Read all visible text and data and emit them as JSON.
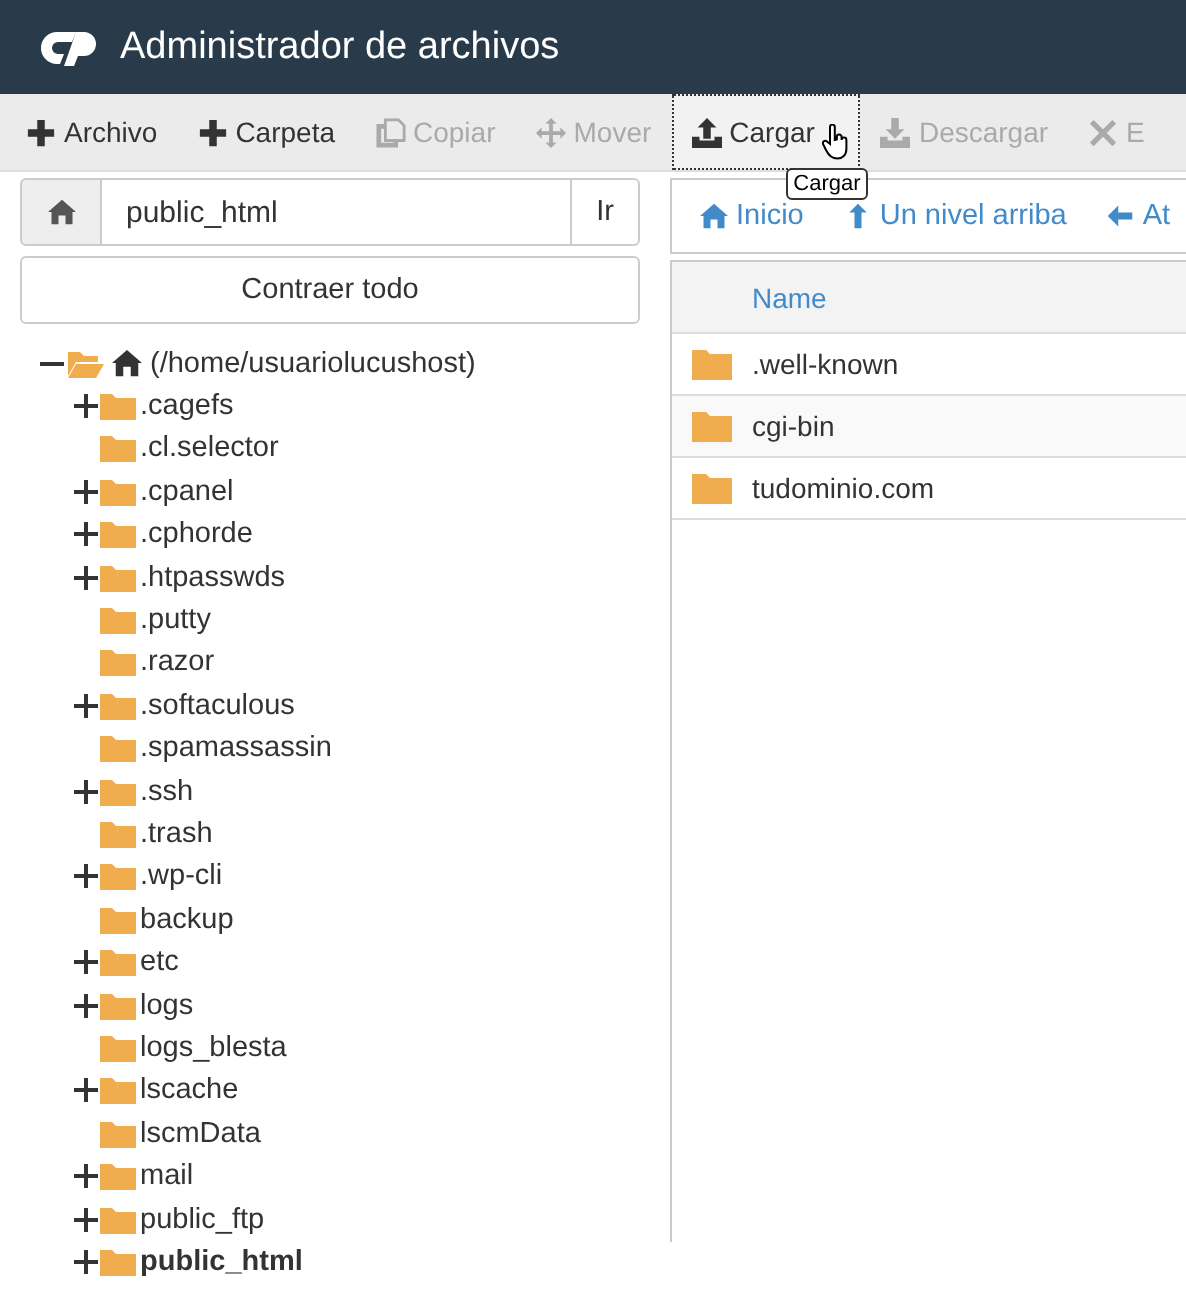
{
  "header": {
    "title": "Administrador de archivos"
  },
  "toolbar": [
    {
      "kind": "plus",
      "label": "Archivo",
      "disabled": false,
      "selected": false
    },
    {
      "kind": "plus",
      "label": "Carpeta",
      "disabled": false,
      "selected": false
    },
    {
      "kind": "copy",
      "label": "Copiar",
      "disabled": true,
      "selected": false
    },
    {
      "kind": "move",
      "label": "Mover",
      "disabled": true,
      "selected": false
    },
    {
      "kind": "upload",
      "label": "Cargar",
      "disabled": false,
      "selected": true
    },
    {
      "kind": "download",
      "label": "Descargar",
      "disabled": true,
      "selected": false
    },
    {
      "kind": "delete",
      "label": "E",
      "disabled": true,
      "selected": false
    }
  ],
  "tooltip": "Cargar",
  "path_bar": {
    "value": "public_html",
    "go": "Ir"
  },
  "collapse_all": "Contraer todo",
  "tree": {
    "label": "(/home/usuariolucushost)",
    "expanded": true,
    "children": [
      {
        "label": ".cagefs",
        "has_children": true,
        "selected": false
      },
      {
        "label": ".cl.selector",
        "has_children": false,
        "selected": false
      },
      {
        "label": ".cpanel",
        "has_children": true,
        "selected": false
      },
      {
        "label": ".cphorde",
        "has_children": true,
        "selected": false
      },
      {
        "label": ".htpasswds",
        "has_children": true,
        "selected": false
      },
      {
        "label": ".putty",
        "has_children": false,
        "selected": false
      },
      {
        "label": ".razor",
        "has_children": false,
        "selected": false
      },
      {
        "label": ".softaculous",
        "has_children": true,
        "selected": false
      },
      {
        "label": ".spamassassin",
        "has_children": false,
        "selected": false
      },
      {
        "label": ".ssh",
        "has_children": true,
        "selected": false
      },
      {
        "label": ".trash",
        "has_children": false,
        "selected": false
      },
      {
        "label": ".wp-cli",
        "has_children": true,
        "selected": false
      },
      {
        "label": "backup",
        "has_children": false,
        "selected": false
      },
      {
        "label": "etc",
        "has_children": true,
        "selected": false
      },
      {
        "label": "logs",
        "has_children": true,
        "selected": false
      },
      {
        "label": "logs_blesta",
        "has_children": false,
        "selected": false
      },
      {
        "label": "lscache",
        "has_children": true,
        "selected": false
      },
      {
        "label": "lscmData",
        "has_children": false,
        "selected": false
      },
      {
        "label": "mail",
        "has_children": true,
        "selected": false
      },
      {
        "label": "public_ftp",
        "has_children": true,
        "selected": false
      },
      {
        "label": "public_html",
        "has_children": true,
        "selected": true
      }
    ]
  },
  "nav": [
    {
      "kind": "home",
      "label": "Inicio"
    },
    {
      "kind": "up",
      "label": "Un nivel arriba"
    },
    {
      "kind": "back",
      "label": "At"
    }
  ],
  "table": {
    "columns": [
      "Name"
    ],
    "rows": [
      {
        "name": ".well-known"
      },
      {
        "name": "cgi-bin"
      },
      {
        "name": "tudominio.com"
      }
    ]
  }
}
